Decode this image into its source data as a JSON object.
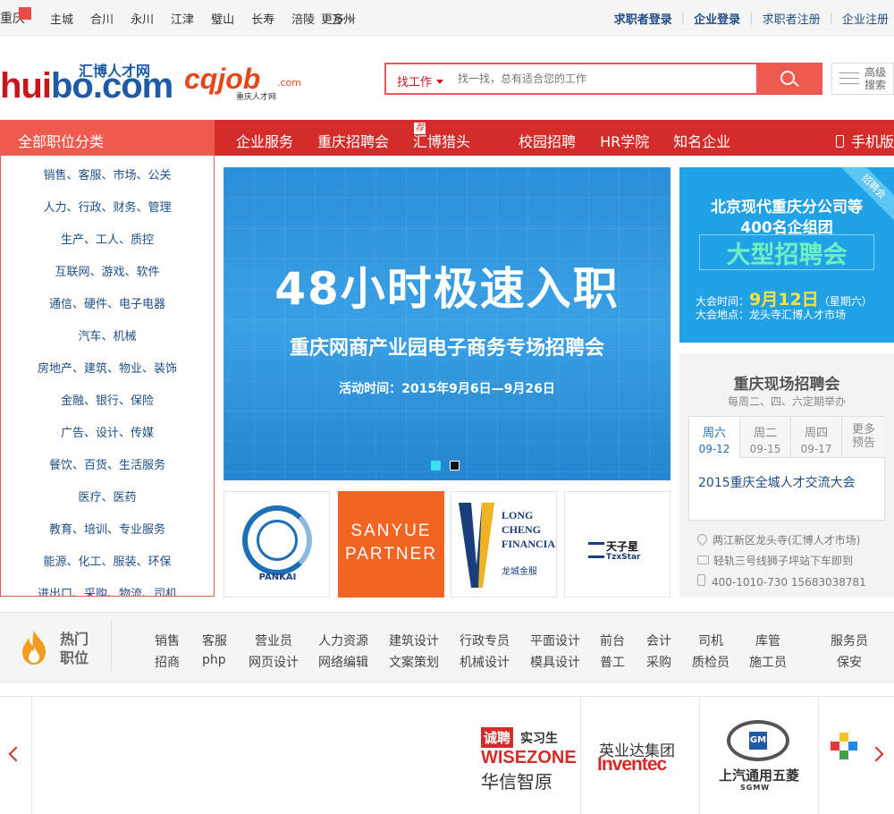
{
  "topbar": {
    "city": "重庆",
    "cities": [
      "主城",
      "合川",
      "永川",
      "江津",
      "璧山",
      "长寿",
      "涪陵",
      "万州"
    ],
    "more": "更多",
    "links": [
      "求职者登录",
      "企业登录",
      "求职者注册",
      "企业注册"
    ]
  },
  "header": {
    "logo1_text": "huibo.com",
    "logo1_cn": "汇博人才网",
    "logo2_text": "cqjob",
    "logo2_com": ".com",
    "logo2_cn": "重庆人才网",
    "search_category": "找工作",
    "search_placeholder": "找一找，总有适合您的工作",
    "advanced_search": [
      "高级",
      "搜索"
    ]
  },
  "nav": {
    "all_categories": "全部职位分类",
    "items": [
      "企业服务",
      "重庆招聘会",
      "汇博猎头",
      "校园招聘",
      "HR学院",
      "知名企业"
    ],
    "hot_badge": "荐",
    "mobile": "手机版"
  },
  "categories": [
    "销售、客服、市场、公关",
    "人力、行政、财务、管理",
    "生产、工人、质控",
    "互联网、游戏、软件",
    "通信、硬件、电子电器",
    "汽车、机械",
    "房地产、建筑、物业、装饰",
    "金融、银行、保险",
    "广告、设计、传媒",
    "餐饮、百货、生活服务",
    "医疗、医药",
    "教育、培训、专业服务",
    "能源、化工、服装、环保",
    "进出口、采购、物流、司机"
  ],
  "banner": {
    "headline": "48小时极速入职",
    "subheadline": "重庆网商产业园电子商务专场招聘会",
    "time": "活动时间：2015年9月6日—9月26日",
    "slides": 2,
    "active_slide": 1
  },
  "partners_row": {
    "pankai": "PANKAI",
    "sanyue": [
      "SANYUE",
      "PARTNER"
    ],
    "longcheng": [
      "LONG CHENG",
      "FINANCIAL"
    ],
    "longcheng_cn": "龙城金服",
    "tzx_cn": "天子星",
    "tzx_en": "TzxStar"
  },
  "fair_card": {
    "ribbon": "招聘会",
    "line1": "北京现代重庆分公司等",
    "line2": "400名企组团",
    "line3": "大型招聘会",
    "time_label": "大会时间：",
    "date": "9月12日",
    "weekday": "（星期六）",
    "place": "大会地点：龙头寺汇博人才市场"
  },
  "onsite": {
    "title": "重庆现场招聘会",
    "subtitle": "每周二、四、六定期举办",
    "tabs": [
      {
        "day": "周六",
        "date": "09-12"
      },
      {
        "day": "周二",
        "date": "09-15"
      },
      {
        "day": "周四",
        "date": "09-17"
      }
    ],
    "more_tab": [
      "更多",
      "预告"
    ],
    "event": "2015重庆全城人才交流大会",
    "address": "两江新区龙头寺(汇博人才市场)",
    "transit": "轻轨三号线狮子坪站下车即到",
    "phone": "400-1010-730 15683038781"
  },
  "hot_jobs": {
    "label": [
      "热门",
      "职位"
    ],
    "row1": [
      "销售",
      "客服",
      "营业员",
      "人力资源",
      "建筑设计",
      "行政专员",
      "平面设计",
      "前台",
      "会计",
      "司机",
      "库管",
      "服务员"
    ],
    "row2": [
      "招商",
      "php",
      "网页设计",
      "网络编辑",
      "文案策划",
      "机械设计",
      "模具设计",
      "普工",
      "采购",
      "质检员",
      "施工员",
      "保安"
    ]
  },
  "partner_strip": {
    "chengpin_badge": "诚聘",
    "chengpin_intern": "实习生",
    "wisezone": "WISEZONE",
    "wisezone_cn": "华信智原",
    "inventec_cn": "英业达集团",
    "inventec": "Inventec",
    "sgmw_cn": "上汽通用五菱",
    "sgmw": "SGMW",
    "gm": "GM"
  }
}
